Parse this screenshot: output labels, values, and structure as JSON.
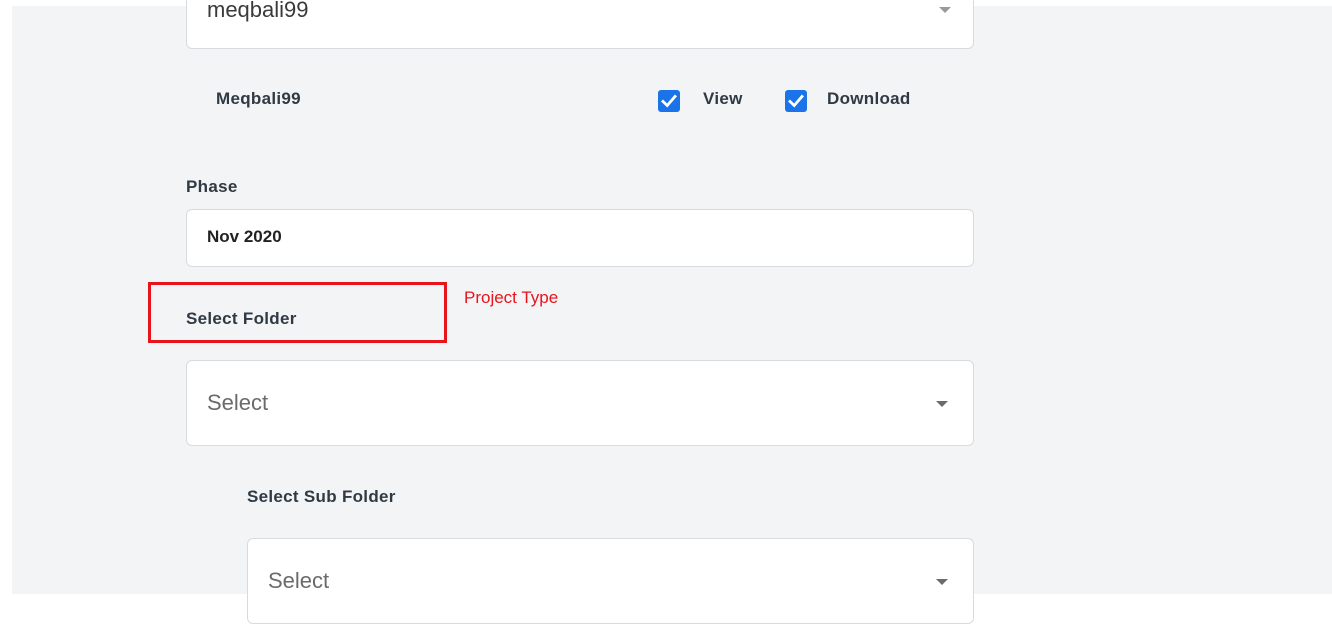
{
  "user_select": {
    "value": "meqbali99"
  },
  "permissions": {
    "username": "Meqbali99",
    "view_label": "View",
    "view_checked": true,
    "download_label": "Download",
    "download_checked": true
  },
  "phase": {
    "label": "Phase",
    "value": "Nov 2020"
  },
  "folder": {
    "label": "Select Folder",
    "placeholder": "Select"
  },
  "sub_folder": {
    "label": "Select Sub Folder",
    "placeholder": "Select"
  },
  "annotation": {
    "text": "Project Type",
    "color": "#e8141b"
  },
  "colors": {
    "accent": "#1a73e8",
    "panel": "#f3f4f6"
  }
}
